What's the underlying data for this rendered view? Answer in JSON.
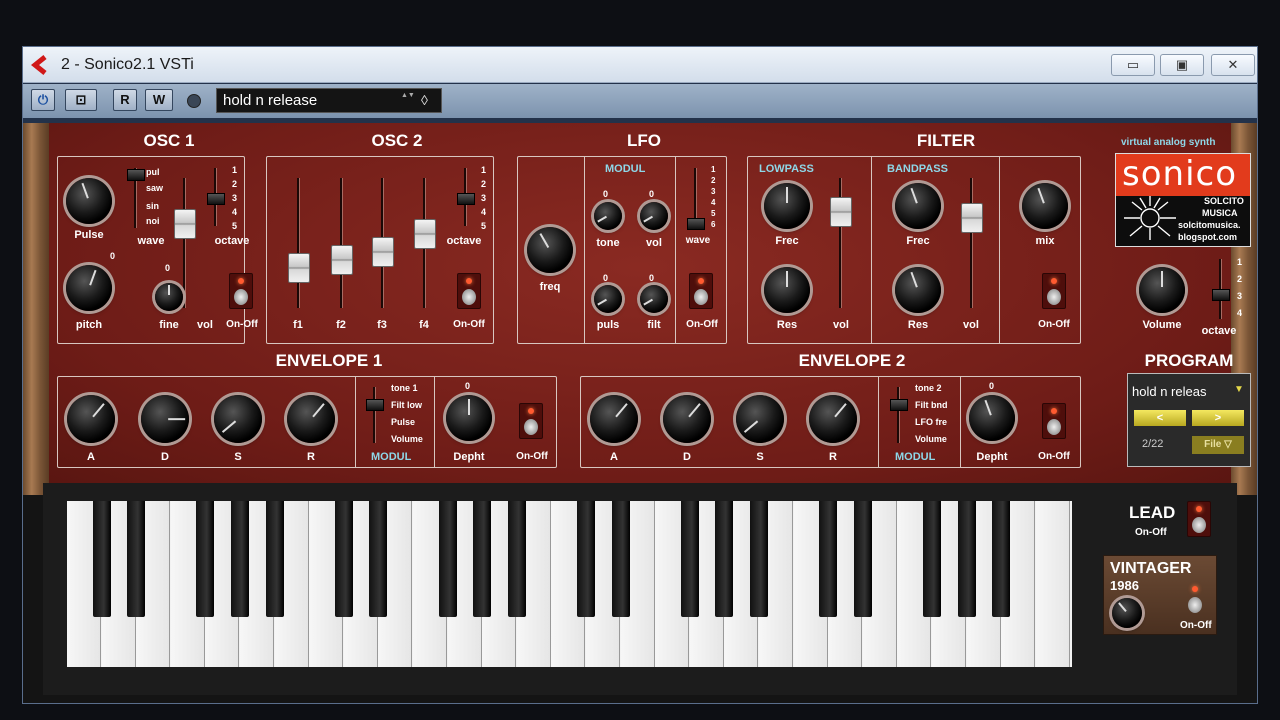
{
  "window": {
    "title": "2 - Sonico2.1 VSTi",
    "min": "▭",
    "max": "▣",
    "close": "✕"
  },
  "toolbar": {
    "power": "⏻",
    "rack": "⊡",
    "read": "R",
    "write": "W",
    "preset": "hold n release",
    "spin": "▲▼",
    "menu": "◊"
  },
  "sections": {
    "osc1": "OSC 1",
    "osc2": "OSC 2",
    "lfo": "LFO",
    "filter": "FILTER",
    "env1": "ENVELOPE 1",
    "env2": "ENVELOPE 2",
    "program": "PROGRAM"
  },
  "osc1": {
    "waves": [
      "pul",
      "saw",
      "sin",
      "noi"
    ],
    "octaves": [
      "1",
      "2",
      "3",
      "4",
      "5"
    ],
    "pulse": "Pulse",
    "wave": "wave",
    "octave": "octave",
    "pitch": "pitch",
    "pitch_val": "0",
    "fine": "fine",
    "fine_val": "0",
    "vol": "vol",
    "onoff": "On-Off"
  },
  "osc2": {
    "faders": [
      "f1",
      "f2",
      "f3",
      "f4"
    ],
    "octaves": [
      "1",
      "2",
      "3",
      "4",
      "5"
    ],
    "octave": "octave",
    "onoff": "On-Off"
  },
  "lfo": {
    "modul": "MODUL",
    "freq": "freq",
    "tone": "tone",
    "vol": "vol",
    "puls": "puls",
    "filt": "filt",
    "zero": "0",
    "wave": "wave",
    "waves": [
      "1",
      "2",
      "3",
      "4",
      "5",
      "6"
    ],
    "onoff": "On-Off"
  },
  "filter": {
    "lowpass": "LOWPASS",
    "bandpass": "BANDPASS",
    "frec": "Frec",
    "res": "Res",
    "vol": "vol",
    "mix": "mix",
    "onoff": "On-Off"
  },
  "logo": {
    "tag": "virtual analog synth",
    "name": "sonico",
    "l1": "SOLCITO",
    "l2": "MUSICA",
    "l3": "solcitomusica.",
    "l4": "blogspot.com"
  },
  "master": {
    "volume": "Volume",
    "octave": "octave",
    "octaves": [
      "1",
      "2",
      "3",
      "4"
    ]
  },
  "env1": {
    "adsr": [
      "A",
      "D",
      "S",
      "R"
    ],
    "targets": [
      "tone 1",
      "Filt low",
      "Pulse",
      "Volume"
    ],
    "modul": "MODUL",
    "depth_val": "0",
    "depth": "Depht",
    "onoff": "On-Off"
  },
  "env2": {
    "adsr": [
      "A",
      "D",
      "S",
      "R"
    ],
    "targets": [
      "tone 2",
      "Filt bnd",
      "LFO fre",
      "Volume"
    ],
    "modul": "MODUL",
    "depth_val": "0",
    "depth": "Depht",
    "onoff": "On-Off"
  },
  "program": {
    "name": "hold n releas",
    "arrow": "▼",
    "prev": "<",
    "next": ">",
    "count": "2/22",
    "file": "File ▽"
  },
  "lead": {
    "label": "LEAD",
    "onoff": "On-Off"
  },
  "vintager": {
    "label": "VINTAGER",
    "year": "1986",
    "onoff": "On-Off"
  },
  "colors": {
    "panel": "#7a211b",
    "accent": "#8ed7e8",
    "led": "#ff5a30"
  }
}
